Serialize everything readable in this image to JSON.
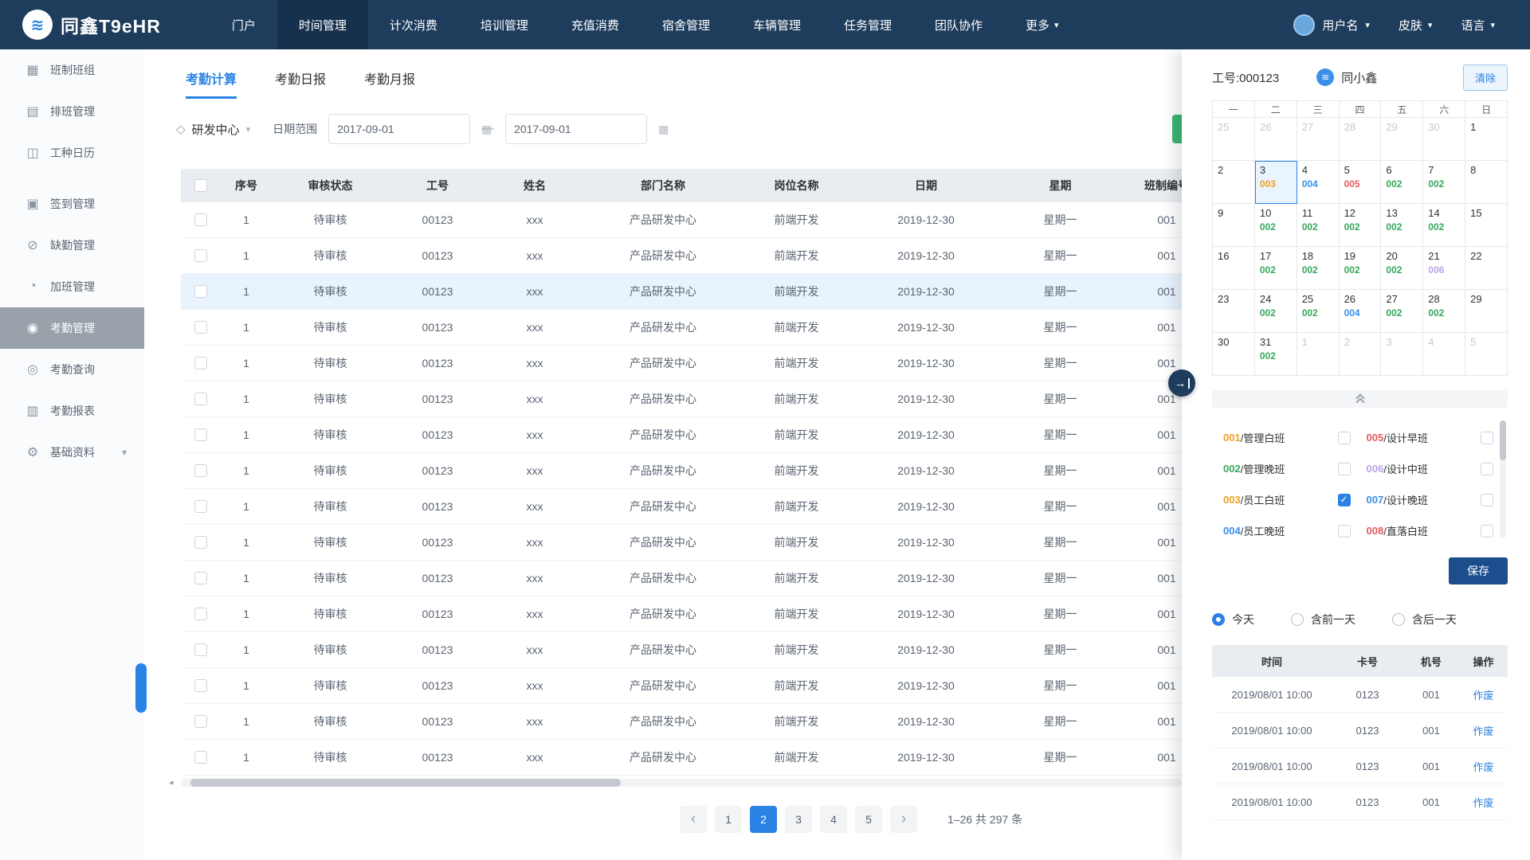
{
  "colors": {
    "accent": "#2a82e4",
    "navbar": "#1e3c5c",
    "navbar_active": "#16314d",
    "save": "#1c4d8c",
    "green": "#3cb470",
    "thead": "#e9ecf0",
    "sidebar_active": "#99a1ab"
  },
  "icons": {
    "caret": "▾",
    "tag": "◇",
    "calendar": "▦",
    "prev": "‹",
    "next": "›",
    "scroll_left": "◂",
    "arrow": "→",
    "logo": "≋"
  },
  "navbar": {
    "logo": "同鑫T9eHR",
    "items": [
      {
        "label": "门户"
      },
      {
        "label": "时间管理",
        "active": true
      },
      {
        "label": "计次消费"
      },
      {
        "label": "培训管理"
      },
      {
        "label": "充值消费"
      },
      {
        "label": "宿舍管理"
      },
      {
        "label": "车辆管理"
      },
      {
        "label": "任务管理"
      },
      {
        "label": "团队协作"
      },
      {
        "label": "更多",
        "caret": true
      }
    ],
    "user": "用户名",
    "skin": "皮肤",
    "language": "语言"
  },
  "sidebar": {
    "items": [
      {
        "label": "班制班组",
        "glyph": "▦",
        "icon": "shift-group-icon"
      },
      {
        "label": "排班管理",
        "glyph": "▤",
        "icon": "schedule-icon"
      },
      {
        "label": "工种日历",
        "glyph": "◫",
        "icon": "work-calendar-icon"
      },
      {
        "label": "签到管理",
        "glyph": "▣",
        "icon": "check-in-icon",
        "gap": true
      },
      {
        "label": "缺勤管理",
        "glyph": "⊘",
        "icon": "absence-icon"
      },
      {
        "label": "加班管理",
        "glyph": "◔",
        "icon": "overtime-icon"
      },
      {
        "label": "考勤管理",
        "glyph": "◉",
        "icon": "attendance-icon",
        "active": true
      },
      {
        "label": "考勤查询",
        "glyph": "◎",
        "icon": "attendance-query-icon"
      },
      {
        "label": "考勤报表",
        "glyph": "▥",
        "icon": "attendance-report-icon"
      },
      {
        "label": "基础资料",
        "glyph": "⚙",
        "icon": "base-data-icon",
        "expandable": true
      }
    ]
  },
  "main": {
    "tabs": [
      {
        "label": "考勤计算",
        "active": true
      },
      {
        "label": "考勤日报"
      },
      {
        "label": "考勤月报"
      }
    ],
    "filters": {
      "department": "研发中心",
      "date_range_label": "日期范围",
      "date_from": "2017-09-01",
      "date_to": "2017-09-01"
    },
    "table": {
      "headers": [
        "序号",
        "审核状态",
        "工号",
        "姓名",
        "部门名称",
        "岗位名称",
        "日期",
        "星期",
        "班制编号"
      ],
      "rows": [
        {
          "cells": [
            "1",
            "待审核",
            "00123",
            "xxx",
            "产品研发中心",
            "前端开发",
            "2019-12-30",
            "星期一",
            "001"
          ]
        },
        {
          "cells": [
            "1",
            "待审核",
            "00123",
            "xxx",
            "产品研发中心",
            "前端开发",
            "2019-12-30",
            "星期一",
            "001"
          ]
        },
        {
          "cells": [
            "1",
            "待审核",
            "00123",
            "xxx",
            "产品研发中心",
            "前端开发",
            "2019-12-30",
            "星期一",
            "001"
          ],
          "highlighted": true
        },
        {
          "cells": [
            "1",
            "待审核",
            "00123",
            "xxx",
            "产品研发中心",
            "前端开发",
            "2019-12-30",
            "星期一",
            "001"
          ]
        },
        {
          "cells": [
            "1",
            "待审核",
            "00123",
            "xxx",
            "产品研发中心",
            "前端开发",
            "2019-12-30",
            "星期一",
            "001"
          ]
        },
        {
          "cells": [
            "1",
            "待审核",
            "00123",
            "xxx",
            "产品研发中心",
            "前端开发",
            "2019-12-30",
            "星期一",
            "001"
          ]
        },
        {
          "cells": [
            "1",
            "待审核",
            "00123",
            "xxx",
            "产品研发中心",
            "前端开发",
            "2019-12-30",
            "星期一",
            "001"
          ]
        },
        {
          "cells": [
            "1",
            "待审核",
            "00123",
            "xxx",
            "产品研发中心",
            "前端开发",
            "2019-12-30",
            "星期一",
            "001"
          ]
        },
        {
          "cells": [
            "1",
            "待审核",
            "00123",
            "xxx",
            "产品研发中心",
            "前端开发",
            "2019-12-30",
            "星期一",
            "001"
          ]
        },
        {
          "cells": [
            "1",
            "待审核",
            "00123",
            "xxx",
            "产品研发中心",
            "前端开发",
            "2019-12-30",
            "星期一",
            "001"
          ]
        },
        {
          "cells": [
            "1",
            "待审核",
            "00123",
            "xxx",
            "产品研发中心",
            "前端开发",
            "2019-12-30",
            "星期一",
            "001"
          ]
        },
        {
          "cells": [
            "1",
            "待审核",
            "00123",
            "xxx",
            "产品研发中心",
            "前端开发",
            "2019-12-30",
            "星期一",
            "001"
          ]
        },
        {
          "cells": [
            "1",
            "待审核",
            "00123",
            "xxx",
            "产品研发中心",
            "前端开发",
            "2019-12-30",
            "星期一",
            "001"
          ]
        },
        {
          "cells": [
            "1",
            "待审核",
            "00123",
            "xxx",
            "产品研发中心",
            "前端开发",
            "2019-12-30",
            "星期一",
            "001"
          ]
        },
        {
          "cells": [
            "1",
            "待审核",
            "00123",
            "xxx",
            "产品研发中心",
            "前端开发",
            "2019-12-30",
            "星期一",
            "001"
          ]
        },
        {
          "cells": [
            "1",
            "待审核",
            "00123",
            "xxx",
            "产品研发中心",
            "前端开发",
            "2019-12-30",
            "星期一",
            "001"
          ]
        }
      ]
    },
    "pagination": {
      "pages": [
        {
          "label": "1"
        },
        {
          "label": "2",
          "active": true
        },
        {
          "label": "3"
        },
        {
          "label": "4"
        },
        {
          "label": "5"
        }
      ],
      "summary": "1–26 共 297 条"
    }
  },
  "panel": {
    "employee_no": "工号:000123",
    "employee_name": "同小鑫",
    "clear_label": "清除",
    "save_label": "保存",
    "calendar": {
      "weekdays": [
        "一",
        "二",
        "三",
        "四",
        "五",
        "六",
        "日"
      ],
      "cells": [
        {
          "day": "25",
          "muted": true
        },
        {
          "day": "26",
          "muted": true
        },
        {
          "day": "27",
          "muted": true
        },
        {
          "day": "28",
          "muted": true
        },
        {
          "day": "29",
          "muted": true
        },
        {
          "day": "30",
          "muted": true
        },
        {
          "day": "1"
        },
        {
          "day": "2"
        },
        {
          "day": "3",
          "code": "003",
          "color": "#f0a11e",
          "selected": true
        },
        {
          "day": "4",
          "code": "004",
          "color": "#3a8fe8"
        },
        {
          "day": "5",
          "code": "005",
          "color": "#e35d5b"
        },
        {
          "day": "6",
          "code": "002",
          "color": "#35a85c"
        },
        {
          "day": "7",
          "code": "002",
          "color": "#35a85c"
        },
        {
          "day": "8"
        },
        {
          "day": "9"
        },
        {
          "day": "10",
          "code": "002",
          "color": "#35a85c"
        },
        {
          "day": "11",
          "code": "002",
          "color": "#35a85c"
        },
        {
          "day": "12",
          "code": "002",
          "color": "#35a85c"
        },
        {
          "day": "13",
          "code": "002",
          "color": "#35a85c"
        },
        {
          "day": "14",
          "code": "002",
          "color": "#35a85c"
        },
        {
          "day": "15"
        },
        {
          "day": "16"
        },
        {
          "day": "17",
          "code": "002",
          "color": "#35a85c"
        },
        {
          "day": "18",
          "code": "002",
          "color": "#35a85c"
        },
        {
          "day": "19",
          "code": "002",
          "color": "#35a85c"
        },
        {
          "day": "20",
          "code": "002",
          "color": "#35a85c"
        },
        {
          "day": "21",
          "code": "006",
          "color": "#b9a4ea"
        },
        {
          "day": "22"
        },
        {
          "day": "23"
        },
        {
          "day": "24",
          "code": "002",
          "color": "#35a85c"
        },
        {
          "day": "25",
          "code": "002",
          "color": "#35a85c"
        },
        {
          "day": "26",
          "code": "004",
          "color": "#3a8fe8"
        },
        {
          "day": "27",
          "code": "002",
          "color": "#35a85c"
        },
        {
          "day": "28",
          "code": "002",
          "color": "#35a85c"
        },
        {
          "day": "29"
        },
        {
          "day": "30"
        },
        {
          "day": "31",
          "code": "002",
          "color": "#35a85c"
        },
        {
          "day": "1",
          "muted": true
        },
        {
          "day": "2",
          "muted": true
        },
        {
          "day": "3",
          "muted": true
        },
        {
          "day": "4",
          "muted": true
        },
        {
          "day": "5",
          "muted": true
        }
      ]
    },
    "shifts": [
      {
        "code": "001",
        "name": "管理白班",
        "color": "#f0a11e",
        "checked": false
      },
      {
        "code": "005",
        "name": "设计早班",
        "color": "#e35d5b",
        "checked": false
      },
      {
        "code": "002",
        "name": "管理晚班",
        "color": "#35a85c",
        "checked": false
      },
      {
        "code": "006",
        "name": "设计中班",
        "color": "#b9a4ea",
        "checked": false
      },
      {
        "code": "003",
        "name": "员工白班",
        "color": "#f0a11e",
        "checked": true
      },
      {
        "code": "007",
        "name": "设计晚班",
        "color": "#3a8fe8",
        "checked": false
      },
      {
        "code": "004",
        "name": "员工晚班",
        "color": "#3a8fe8",
        "checked": false
      },
      {
        "code": "008",
        "name": "直落白班",
        "color": "#e35d5b",
        "checked": false
      }
    ],
    "radios": [
      {
        "label": "今天",
        "checked": true
      },
      {
        "label": "含前一天",
        "checked": false
      },
      {
        "label": "含后一天",
        "checked": false
      }
    ],
    "log": {
      "headers": [
        "时间",
        "卡号",
        "机号",
        "操作"
      ],
      "rows": [
        {
          "time": "2019/08/01 10:00",
          "card": "0123",
          "machine": "001",
          "action": "作废"
        },
        {
          "time": "2019/08/01 10:00",
          "card": "0123",
          "machine": "001",
          "action": "作废"
        },
        {
          "time": "2019/08/01 10:00",
          "card": "0123",
          "machine": "001",
          "action": "作废"
        },
        {
          "time": "2019/08/01 10:00",
          "card": "0123",
          "machine": "001",
          "action": "作废"
        }
      ]
    }
  }
}
